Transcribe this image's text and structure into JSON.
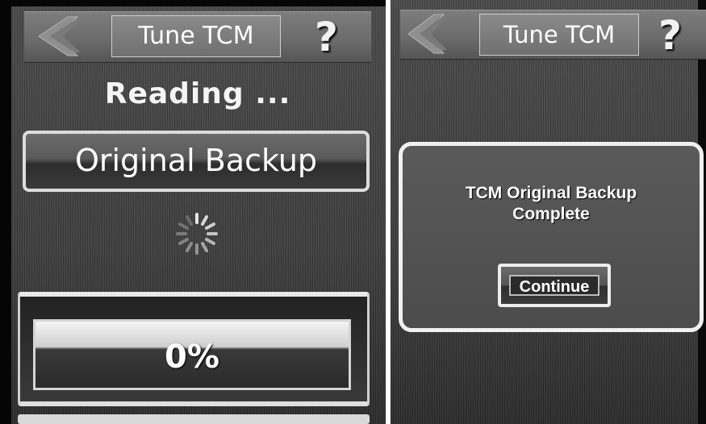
{
  "left_screen": {
    "header": {
      "title": "Tune TCM",
      "help_label": "?"
    },
    "status_text": "Reading ...",
    "operation_button_label": "Original Backup",
    "progress": {
      "value": 0,
      "label": "0%"
    }
  },
  "right_screen": {
    "header": {
      "title": "Tune TCM",
      "help_label": "?"
    },
    "dialog": {
      "message_line1": "TCM Original Backup",
      "message_line2": "Complete",
      "continue_label": "Continue"
    }
  }
}
